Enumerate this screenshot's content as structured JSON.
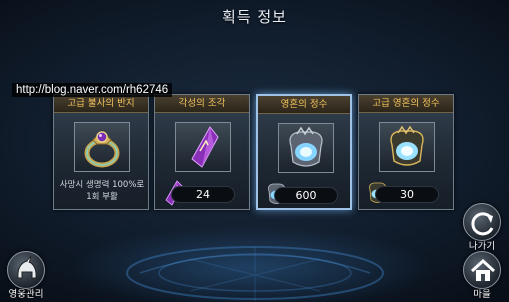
{
  "screen": {
    "title": "획득 정보"
  },
  "watermark": "http://blog.naver.com/rh62746",
  "cards": [
    {
      "name": "고급 불사의 반지",
      "icon": "ring-icon",
      "description": "사망시 생명력 100%로 1회 부활"
    },
    {
      "name": "각성의 조각",
      "icon": "crystal-shard-icon",
      "quantity": "24"
    },
    {
      "name": "영혼의 정수",
      "icon": "soul-essence-icon",
      "quantity": "600"
    },
    {
      "name": "고급 영혼의 정수",
      "icon": "advanced-soul-essence-icon",
      "quantity": "30"
    }
  ],
  "buttons": {
    "exit_label": "나가기",
    "village_label": "마을",
    "hero_manage_label": "영웅관리"
  },
  "colors": {
    "item_name": "#f3c35a",
    "selected_border": "#9fc3e6"
  }
}
